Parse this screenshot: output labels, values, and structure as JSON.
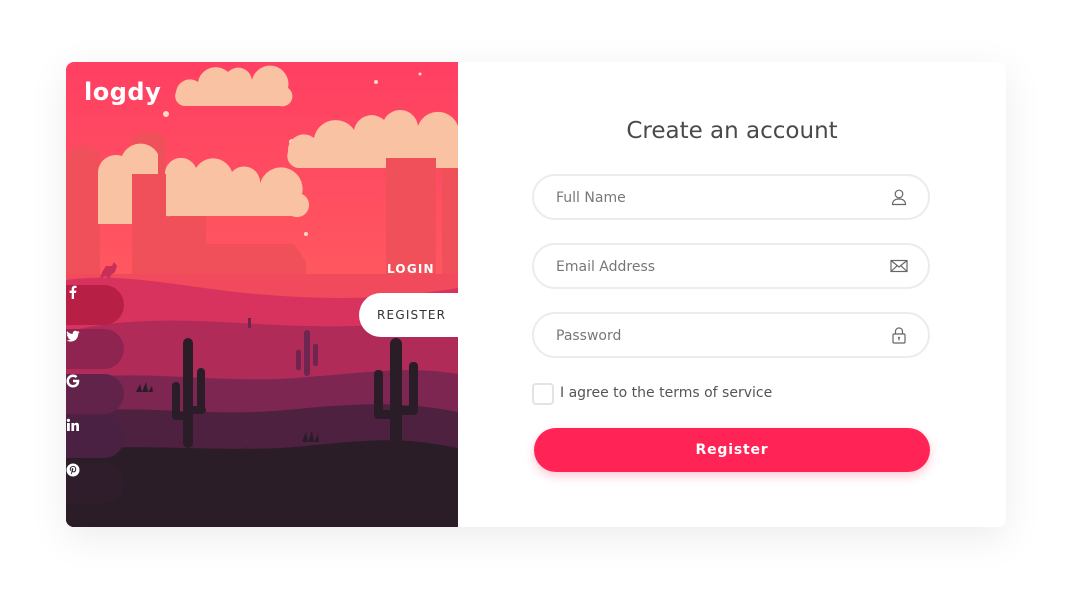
{
  "brand": {
    "logo": "logdy"
  },
  "auth_tabs": {
    "login": "LOGIN",
    "register": "REGISTER",
    "active": "register"
  },
  "social": [
    {
      "name": "facebook",
      "icon": "facebook-icon"
    },
    {
      "name": "twitter",
      "icon": "twitter-icon"
    },
    {
      "name": "google",
      "icon": "google-icon"
    },
    {
      "name": "linkedin",
      "icon": "linkedin-icon"
    },
    {
      "name": "pinterest",
      "icon": "pinterest-icon"
    }
  ],
  "form": {
    "title": "Create an account",
    "full_name": {
      "placeholder": "Full Name",
      "value": "",
      "icon": "user-icon"
    },
    "email": {
      "placeholder": "Email Address",
      "value": "",
      "icon": "envelope-icon"
    },
    "password": {
      "placeholder": "Password",
      "value": "",
      "icon": "lock-icon"
    },
    "terms": {
      "label": "I agree to the terms of service",
      "checked": false
    },
    "submit_label": "Register"
  },
  "colors": {
    "accent": "#ff2356",
    "sky_top": "#ff3f63",
    "sky_bottom": "#ff7a5c",
    "cloud": "#f9c3a3",
    "ground_dark": "#2b1d28"
  }
}
